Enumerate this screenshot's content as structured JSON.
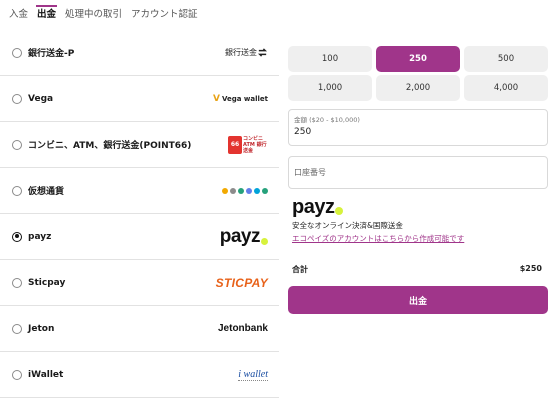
{
  "tabs": [
    {
      "label": "入金",
      "active": false
    },
    {
      "label": "出金",
      "active": true
    },
    {
      "label": "処理中の取引",
      "active": false
    },
    {
      "label": "アカウント認証",
      "active": false
    }
  ],
  "methods": [
    {
      "label": "銀行送金-P",
      "logo_text": "銀行送金",
      "selected": false
    },
    {
      "label": "Vega",
      "logo_text": "Vega wallet",
      "selected": false
    },
    {
      "label": "コンビニ、ATM、銀行送金(POINT66)",
      "logo_box": "66",
      "logo_text": "コンビニ ATM 銀行送金",
      "selected": false
    },
    {
      "label": "仮想通貨",
      "logo_icon": "crypto-coins-icon",
      "selected": false
    },
    {
      "label": "payz",
      "logo_text": "payz",
      "selected": true
    },
    {
      "label": "Sticpay",
      "logo_text": "STICPAY",
      "selected": false
    },
    {
      "label": "Jeton",
      "logo_text": "Jetonbank",
      "selected": false
    },
    {
      "label": "iWallet",
      "logo_text": "i wallet",
      "selected": false
    }
  ],
  "amounts": [
    {
      "label": "100",
      "selected": false
    },
    {
      "label": "250",
      "selected": true
    },
    {
      "label": "500",
      "selected": false
    },
    {
      "label": "1,000",
      "selected": false
    },
    {
      "label": "2,000",
      "selected": false
    },
    {
      "label": "4,000",
      "selected": false
    }
  ],
  "amount_field": {
    "label": "金額 ($20 - $10,000)",
    "value": "250"
  },
  "account_field": {
    "placeholder": "口座番号"
  },
  "payz_info": {
    "brand": "payz",
    "description": "安全なオンライン決済&国際送金",
    "link": "エコペイズのアカウントはこちらから作成可能です"
  },
  "total": {
    "label": "合計",
    "value": "$250"
  },
  "submit_label": "出金",
  "colors": {
    "accent": "#a0358a",
    "payz_dot": "#d7f23c",
    "sticpay": "#e8621a"
  }
}
